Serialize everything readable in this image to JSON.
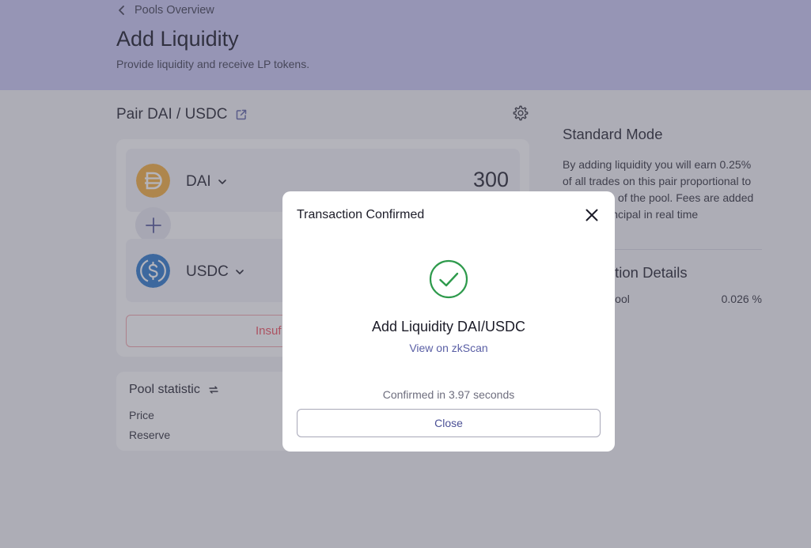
{
  "header": {
    "back_label": "Pools Overview",
    "title": "Add Liquidity",
    "subtitle": "Provide liquidity and receive LP tokens."
  },
  "pair": {
    "title": "Pair DAI / USDC"
  },
  "tokens": [
    {
      "symbol": "DAI",
      "amount": "300",
      "icon": "dai-icon",
      "color": "#f5ac37"
    },
    {
      "symbol": "USDC",
      "amount": "",
      "icon": "usdc-icon",
      "color": "#2775ca"
    }
  ],
  "action_button": {
    "label": "Insuf"
  },
  "pool_statistic": {
    "title": "Pool statistic",
    "price_label": "Price",
    "reserve_label": "Reserve"
  },
  "side": {
    "mode_title": "Standard Mode",
    "mode_text": "By adding liquidity you will earn 0.25% of all trades on this pair proportional to your share of the pool. Fees are added to your principal in real time",
    "details_title": "Transaction Details",
    "row_label": "Share of Pool",
    "row_value": "0.026 %"
  },
  "modal": {
    "title": "Transaction Confirmed",
    "heading": "Add Liquidity DAI/USDC",
    "link": "View on zkScan",
    "confirmed": "Confirmed in 3.97 seconds",
    "close_label": "Close"
  },
  "colors": {
    "accent": "#5a5fa5",
    "success": "#2e9a4c",
    "error": "#f04e5c",
    "header_bg": "#c8c6f4"
  }
}
